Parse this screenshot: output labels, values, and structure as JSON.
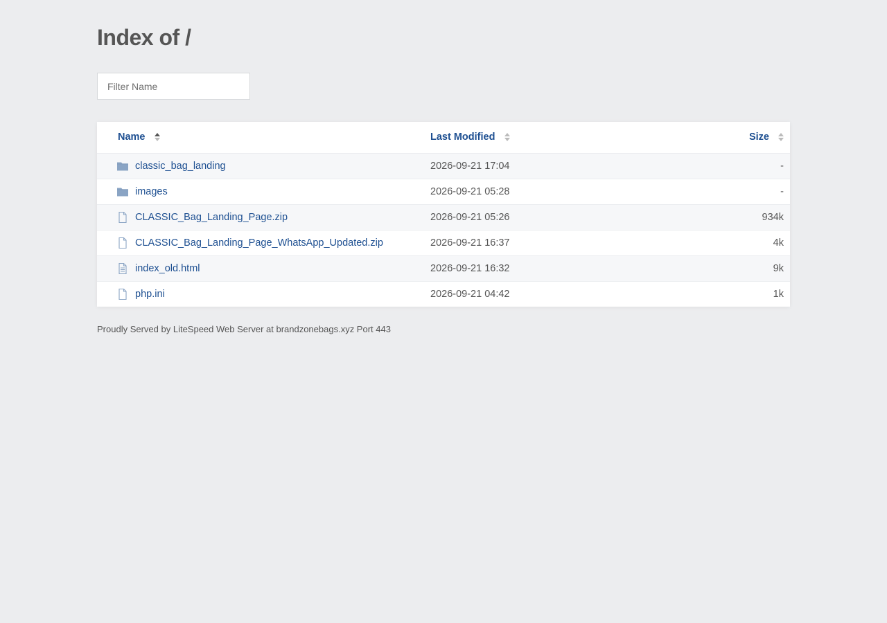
{
  "page": {
    "title": "Index of /"
  },
  "filter": {
    "placeholder": "Filter Name"
  },
  "table": {
    "columns": {
      "name": "Name",
      "modified": "Last Modified",
      "size": "Size"
    },
    "rows": [
      {
        "icon": "folder-icon",
        "name": "classic_bag_landing",
        "modified": "2026-09-21 17:04",
        "size": "-"
      },
      {
        "icon": "folder-icon",
        "name": "images",
        "modified": "2026-09-21 05:28",
        "size": "-"
      },
      {
        "icon": "file-icon",
        "name": "CLASSIC_Bag_Landing_Page.zip",
        "modified": "2026-09-21 05:26",
        "size": "934k"
      },
      {
        "icon": "file-icon",
        "name": "CLASSIC_Bag_Landing_Page_WhatsApp_Updated.zip",
        "modified": "2026-09-21 16:37",
        "size": "4k"
      },
      {
        "icon": "file-text-icon",
        "name": "index_old.html",
        "modified": "2026-09-21 16:32",
        "size": "9k"
      },
      {
        "icon": "file-icon",
        "name": "php.ini",
        "modified": "2026-09-21 04:42",
        "size": "1k"
      }
    ]
  },
  "footer": {
    "text": "Proudly Served by LiteSpeed Web Server at brandzonebags.xyz Port 443"
  },
  "colors": {
    "background": "#ecedef",
    "link": "#1d4f91",
    "folder_icon": "#8aa4c4",
    "file_icon": "#8aa4c4"
  }
}
